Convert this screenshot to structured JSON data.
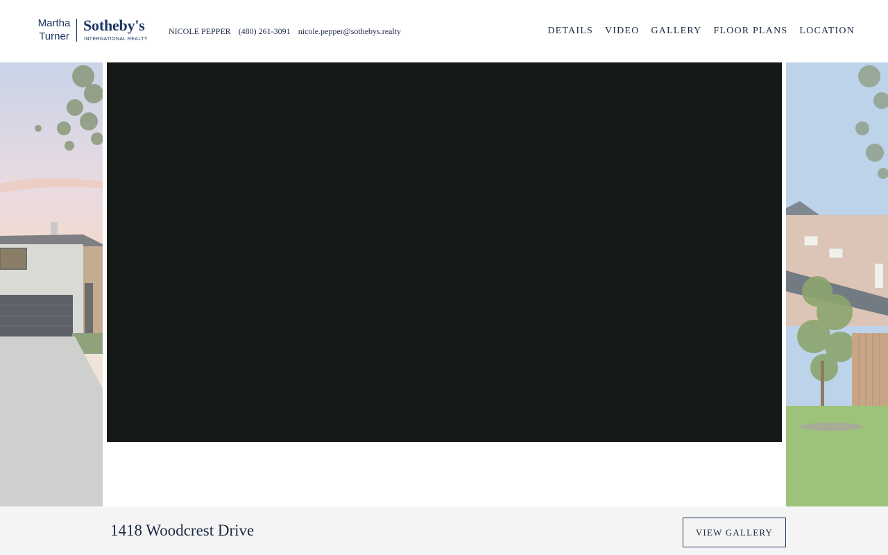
{
  "header": {
    "logo": {
      "line1": "Martha",
      "line2": "Turner",
      "brand": "Sotheby's",
      "sub": "INTERNATIONAL REALTY"
    },
    "agent": {
      "name": "NICOLE PEPPER",
      "phone": "(480) 261-3091",
      "email": "nicole.pepper@sothebys.realty"
    },
    "nav": [
      "DETAILS",
      "VIDEO",
      "GALLERY",
      "FLOOR PLANS",
      "LOCATION"
    ]
  },
  "footer": {
    "address": "1418 Woodcrest Drive",
    "view_gallery_label": "VIEW GALLERY"
  },
  "colors": {
    "brand_navy": "#1c3561",
    "video_bg": "#161a17",
    "footer_bg": "#f4f4f4"
  }
}
